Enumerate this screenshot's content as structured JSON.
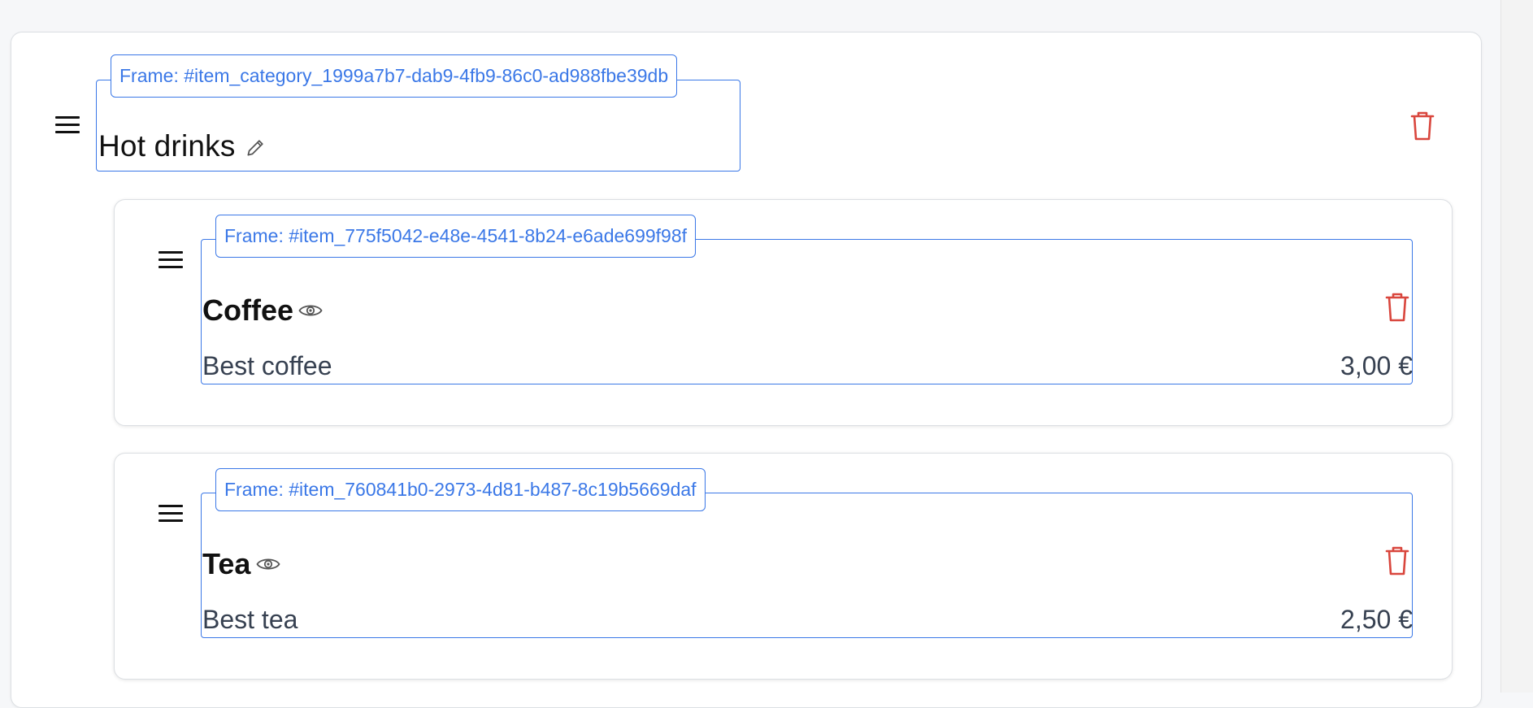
{
  "category": {
    "frame_label": "Frame: #item_category_1999a7b7-dab9-4fb9-86c0-ad988fbe39db",
    "name": "Hot drinks"
  },
  "items": [
    {
      "frame_label": "Frame: #item_775f5042-e48e-4541-8b24-e6ade699f98f",
      "name": "Coffee",
      "description": "Best coffee",
      "price": "3,00 €"
    },
    {
      "frame_label": "Frame: #item_760841b0-2973-4d81-b487-8c19b5669daf",
      "name": "Tea",
      "description": "Best tea",
      "price": "2,50 €"
    }
  ],
  "icons": {
    "drag": "drag-handle-icon",
    "edit": "pencil-icon",
    "visibility": "eye-icon",
    "delete": "trash-icon"
  },
  "colors": {
    "frame_accent": "#3b78e7",
    "delete": "#d9463d",
    "text": "#111111",
    "muted_text": "#374151"
  }
}
